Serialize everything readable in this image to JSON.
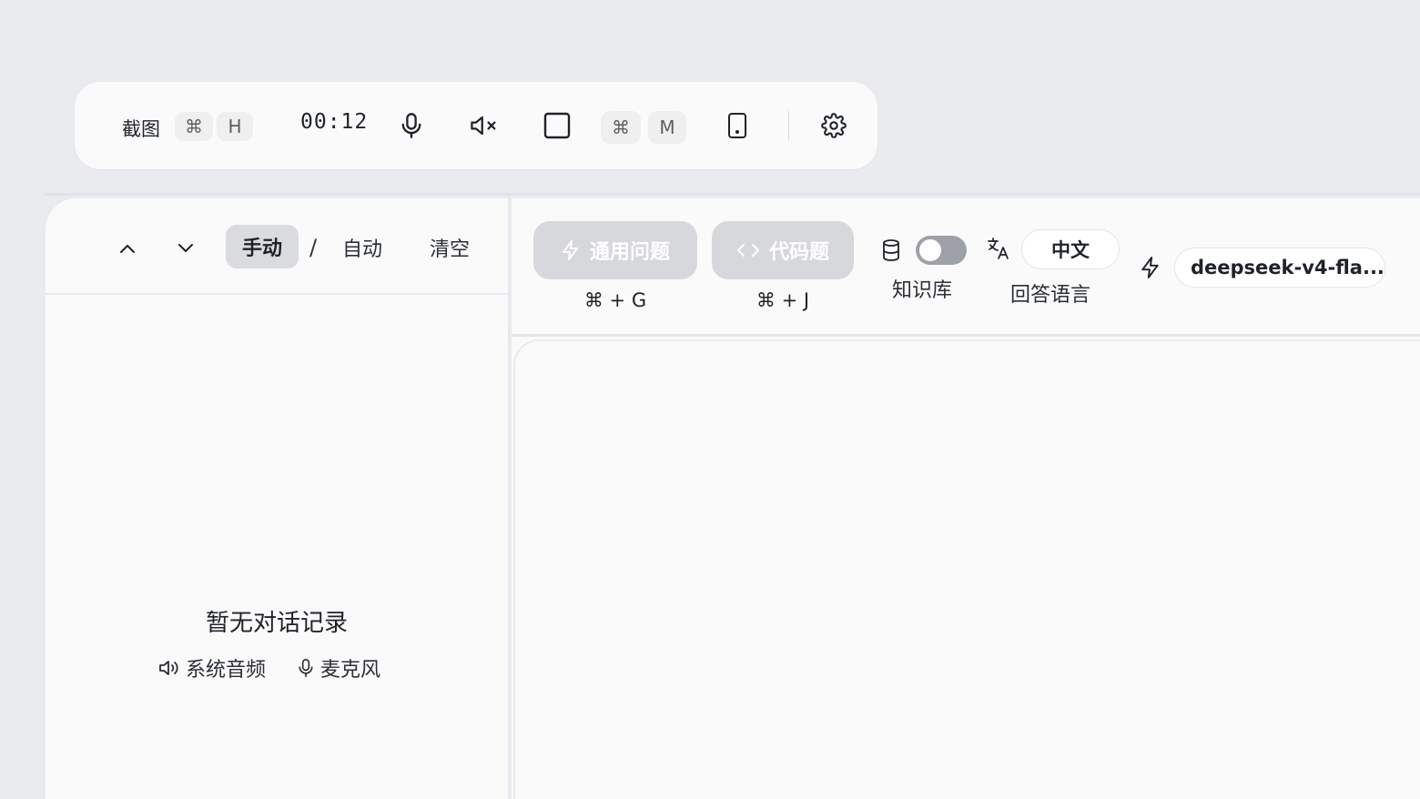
{
  "toolbar": {
    "screenshot_label": "截图",
    "screenshot_key_mod": "⌘",
    "screenshot_key": "H",
    "timer": "00:12",
    "mute_key_mod": "⌘",
    "mute_key": "M"
  },
  "left": {
    "mode_manual": "手动",
    "mode_separator": "/",
    "mode_auto": "自动",
    "clear_label": "清空",
    "empty_title": "暂无对话记录",
    "source_system_audio": "系统音频",
    "source_microphone": "麦克风"
  },
  "right": {
    "general_question_label": "通用问题",
    "general_question_shortcut": "⌘ + G",
    "code_question_label": "代码题",
    "code_question_shortcut": "⌘ + J",
    "knowledge_base_label": "知识库",
    "knowledge_base_enabled": false,
    "answer_language_value": "中文",
    "answer_language_label": "回答语言",
    "model_name": "deepseek-v4-fla..."
  },
  "colors": {
    "background": "#e9ebef",
    "panel": "#fafafa",
    "active_mode_bg": "#d9dbdf",
    "disabled_button_bg": "#d7d8dc",
    "toggle_off": "#9ea1a7"
  },
  "icons": [
    "microphone-icon",
    "speaker-muted-icon",
    "square-icon",
    "phone-icon",
    "gear-icon",
    "chevron-up-icon",
    "chevron-down-icon",
    "lightning-icon",
    "code-icon",
    "database-icon",
    "translate-icon",
    "speaker-icon"
  ]
}
